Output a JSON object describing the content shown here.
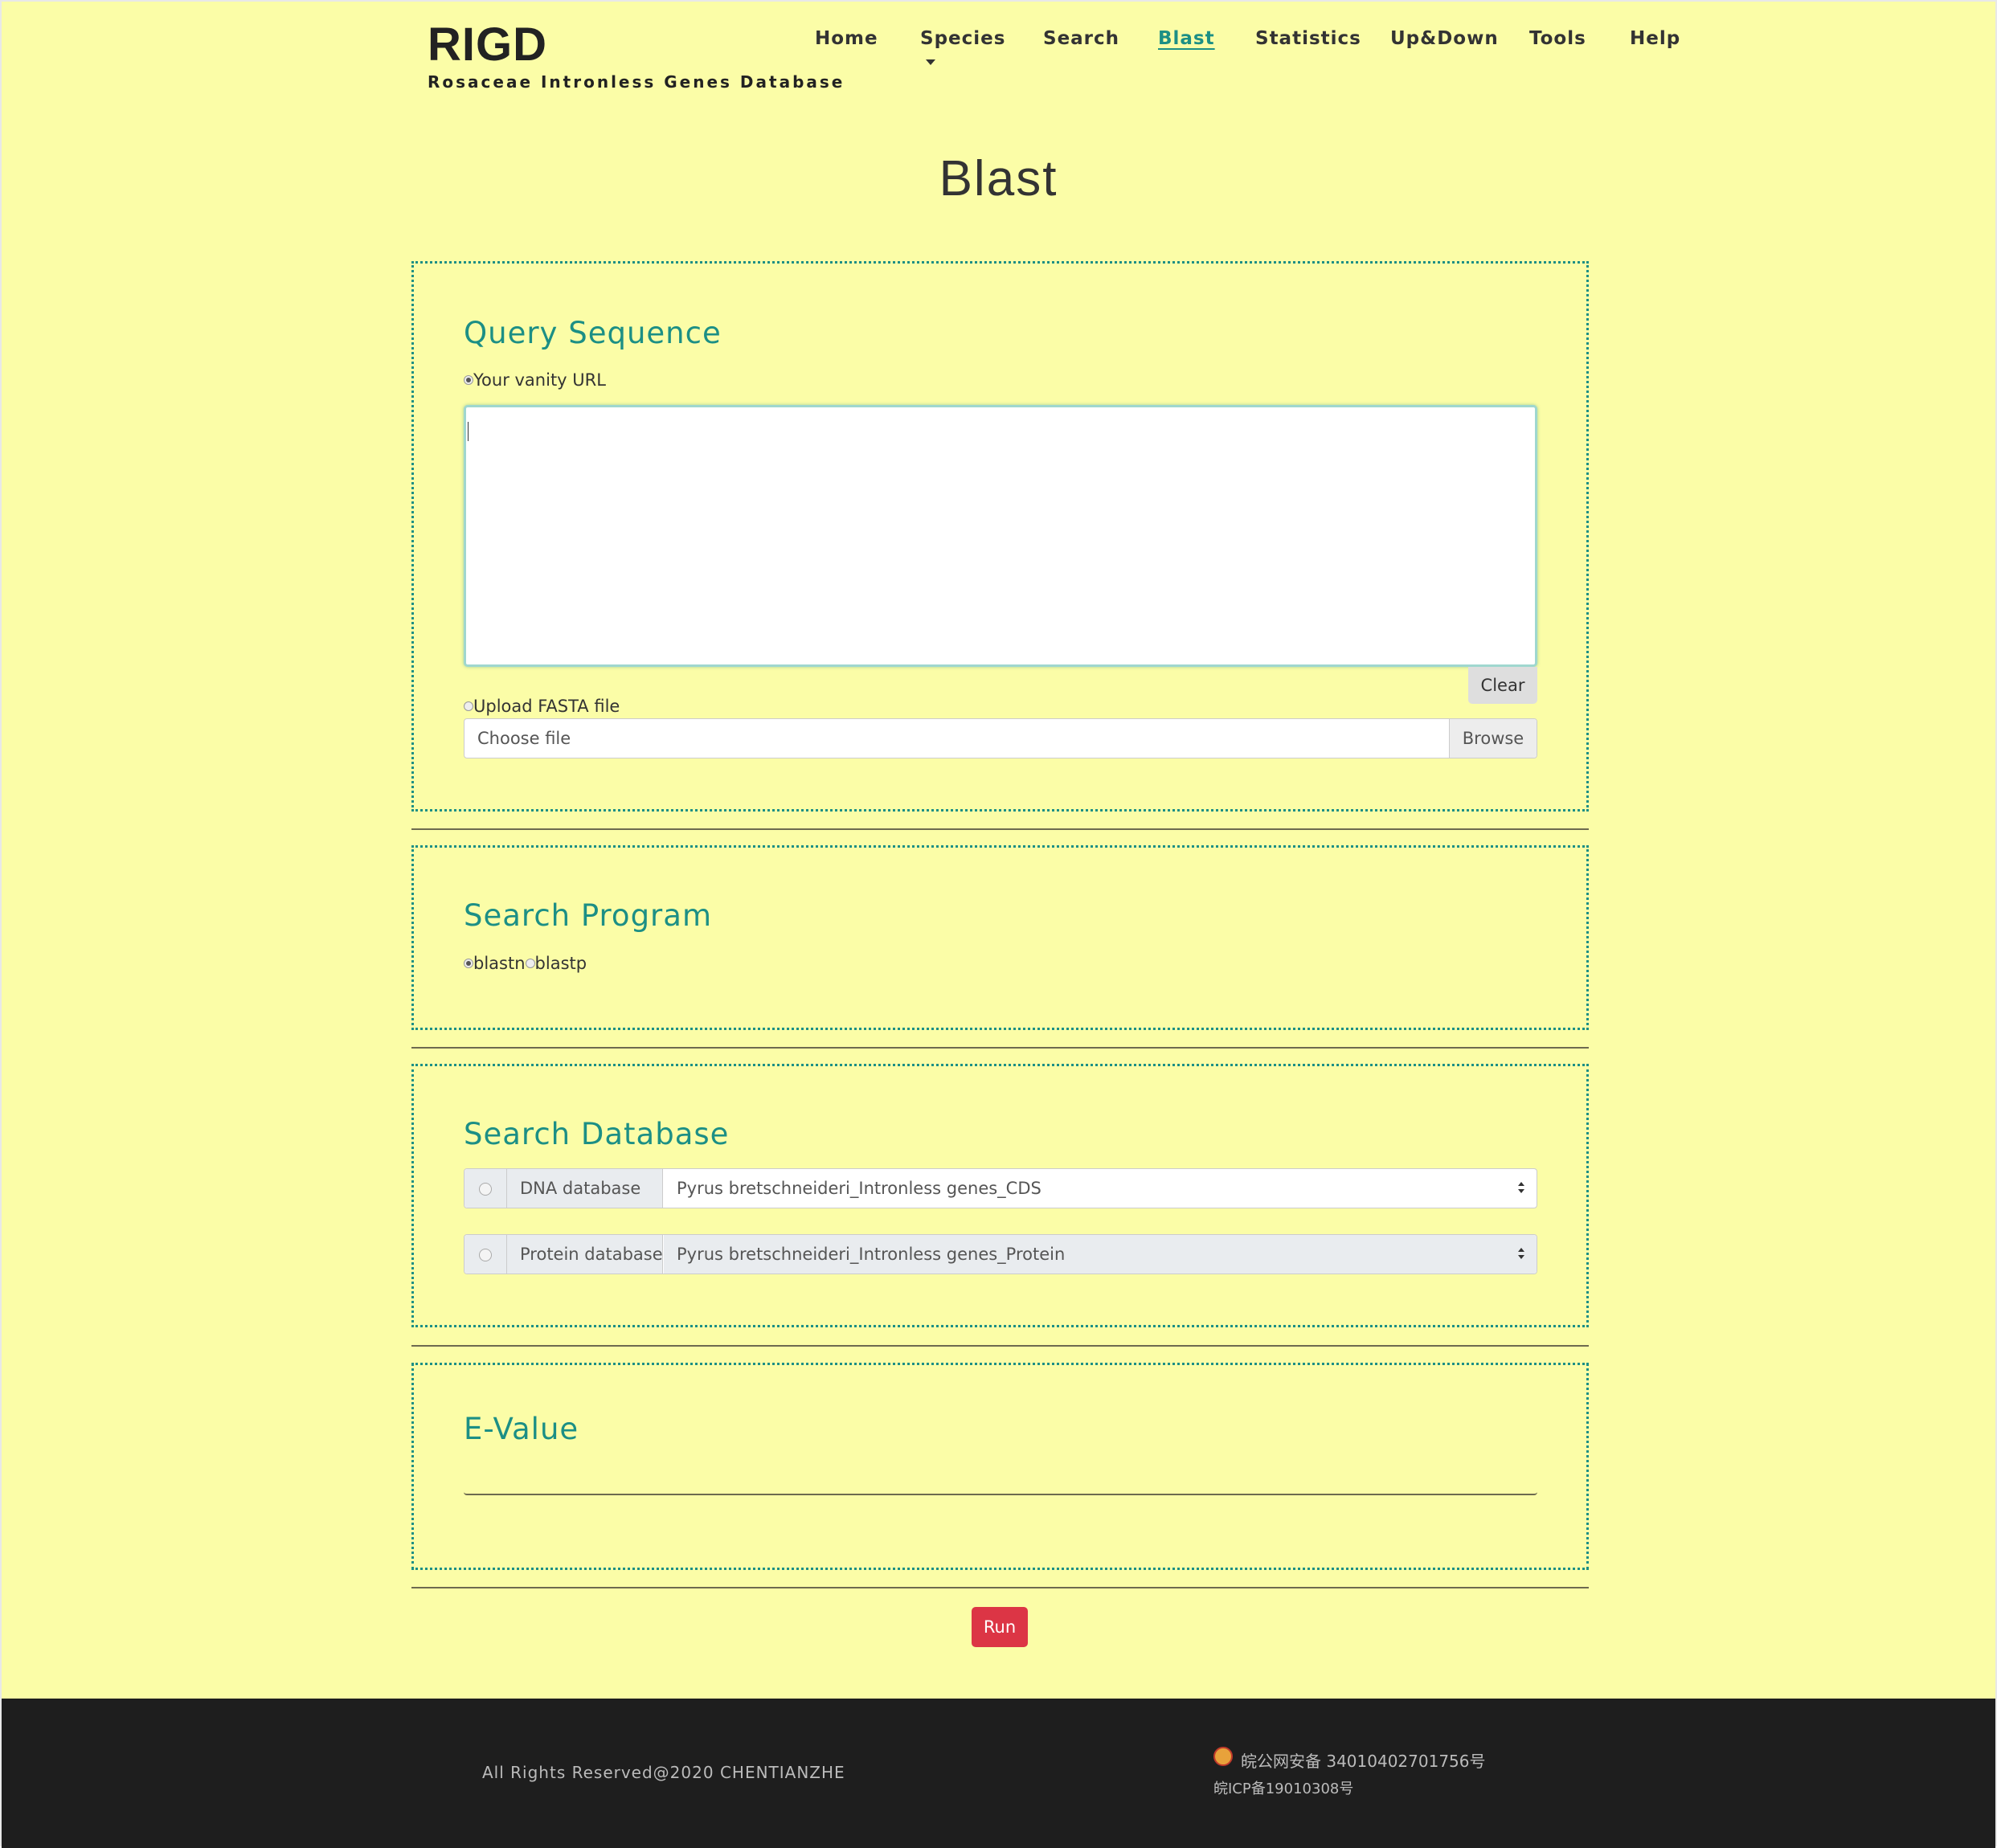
{
  "header": {
    "logo_title": "RIGD",
    "logo_subtitle": "Rosaceae Intronless Genes Database",
    "nav": {
      "home": "Home",
      "species": "Species",
      "search": "Search",
      "blast": "Blast",
      "statistics": "Statistics",
      "updown": "Up&Down",
      "tools": "Tools",
      "help": "Help"
    },
    "active_nav": "Blast"
  },
  "page_title": "Blast",
  "query": {
    "heading": "Query Sequence",
    "option_text_label": "Your vanity URL",
    "sequence_value": "",
    "clear_label": "Clear",
    "option_upload_label": "Upload FASTA file",
    "file_placeholder": "Choose file",
    "browse_label": "Browse"
  },
  "program": {
    "heading": "Search Program",
    "options": [
      "blastn",
      "blastp"
    ],
    "selected": "blastn"
  },
  "database": {
    "heading": "Search Database",
    "dna_label": "DNA database",
    "dna_value": "Pyrus bretschneideri_Intronless genes_CDS",
    "protein_label": "Protein database",
    "protein_value": "Pyrus bretschneideri_Intronless genes_Protein"
  },
  "evalue": {
    "heading": "E-Value",
    "value": ""
  },
  "run_label": "Run",
  "footer": {
    "copyright": "All Rights Reserved@2020 CHENTIANZHE",
    "police_record": "皖公网安备 34010402701756号",
    "icp_record": "皖ICP备19010308号"
  },
  "colors": {
    "background": "#fbfda7",
    "accent": "#1c8f85",
    "run_button": "#dc3545",
    "footer": "#1e1e1e"
  },
  "icons": {
    "dropdown": "caret-down-icon",
    "select": "select-arrows-icon",
    "police": "police-badge-icon"
  }
}
